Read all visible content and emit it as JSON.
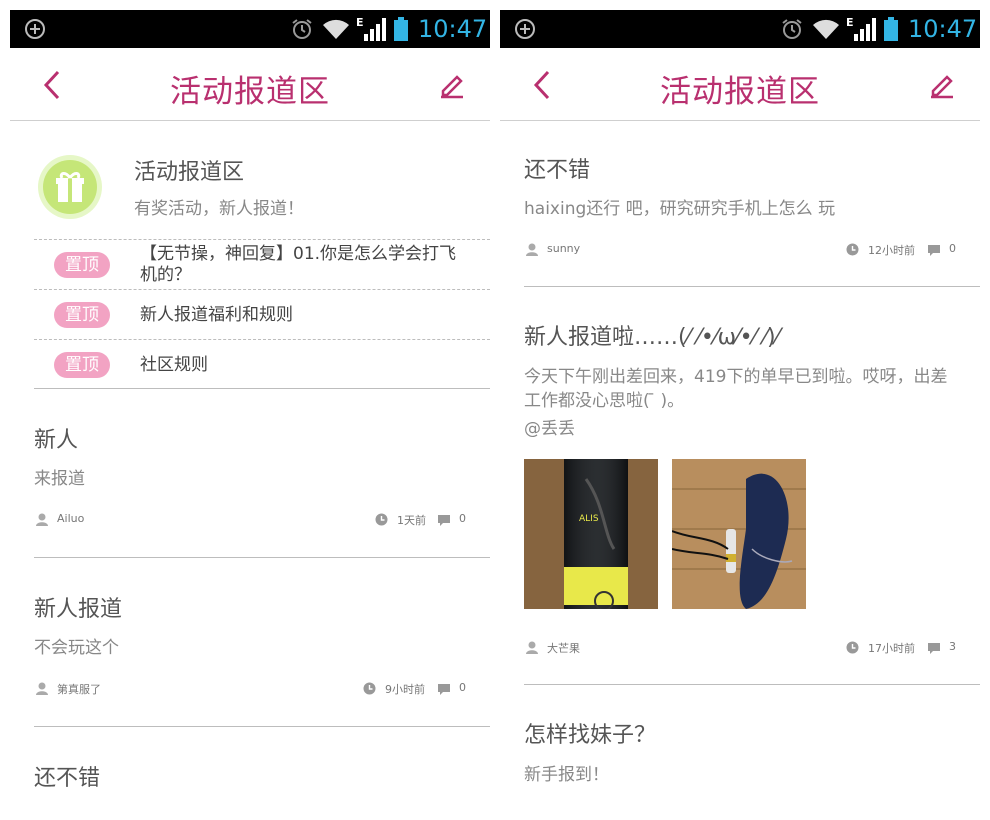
{
  "status_bar": {
    "time": "10:47"
  },
  "header": {
    "title": "活动报道区"
  },
  "forum": {
    "name": "活动报道区",
    "description": "有奖活动，新人报道！"
  },
  "pinned_badge": "置顶",
  "pinned": [
    {
      "text": "【无节操，神回复】01.你是怎么学会打飞机的？"
    },
    {
      "text": "新人报道福利和规则"
    },
    {
      "text": "社区规则"
    }
  ],
  "left_posts": [
    {
      "title": "新人",
      "body": "来报道",
      "user": "Ailuo",
      "time": "1天前",
      "comments": "0"
    },
    {
      "title": "新人报道",
      "body": "不会玩这个",
      "user": "第真服了",
      "time": "9小时前",
      "comments": "0"
    },
    {
      "title": "还不错"
    }
  ],
  "right_posts": [
    {
      "title": "还不错",
      "body": "haixing还行 吧，研究研究手机上怎么 玩",
      "user": "sunny",
      "time": "12小时前",
      "comments": "0"
    },
    {
      "title": "新人报道啦……(⁄ ⁄•⁄ω⁄•⁄ ⁄)⁄",
      "body": "今天下午刚出差回来，419下的单早已到啦。哎呀，出差工作都没心思啦(  ̄ )。",
      "body2": "@丢丢",
      "user": "大芒果",
      "time": "17小时前",
      "comments": "3"
    },
    {
      "title": "怎样找妹子？",
      "body": "新手报到！"
    }
  ],
  "colors": {
    "accent": "#b9306f",
    "badge": "#f2a3c3",
    "status_time": "#33b5e5"
  },
  "icons": [
    "add-circle-icon",
    "alarm-icon",
    "wifi-icon",
    "signal-icon",
    "battery-icon",
    "back-icon",
    "edit-icon",
    "gift-icon",
    "user-icon",
    "clock-icon",
    "comment-icon"
  ]
}
